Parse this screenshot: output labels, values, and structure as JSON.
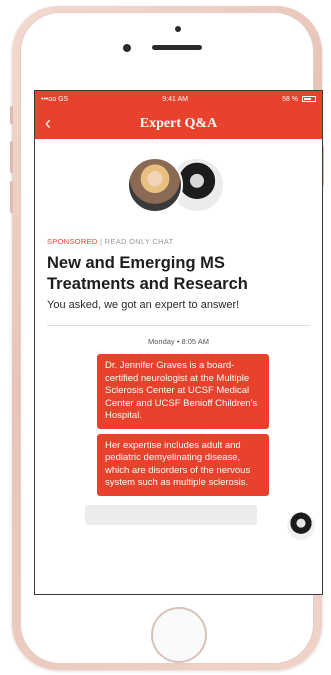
{
  "status_bar": {
    "carrier": "•••oo GS",
    "time": "9:41 AM",
    "battery": "58 %"
  },
  "nav": {
    "back_icon": "chevron-left-icon",
    "title": "Expert Q&A"
  },
  "header": {
    "sponsored": "SPONSORED",
    "separator": "|",
    "read_only": "READ ONLY CHAT",
    "title": "New and Emerging MS Treatments and Research",
    "subtitle": "You asked, we got an expert to answer!"
  },
  "chat": {
    "timestamp": "Monday • 8:05 AM",
    "messages": [
      "Dr. Jennifer Graves is a board-certified neurologist at the Multiple Sclerosis Center at UCSF Medical Center and UCSF Benioff Children's Hospital.",
      "Her expertise includes adult and pediatric demyelinating disease, which are disorders of the nervous system such as multiple sclerosis."
    ]
  },
  "colors": {
    "accent": "#e8412c",
    "phone_shell": "#f0d3c9"
  }
}
